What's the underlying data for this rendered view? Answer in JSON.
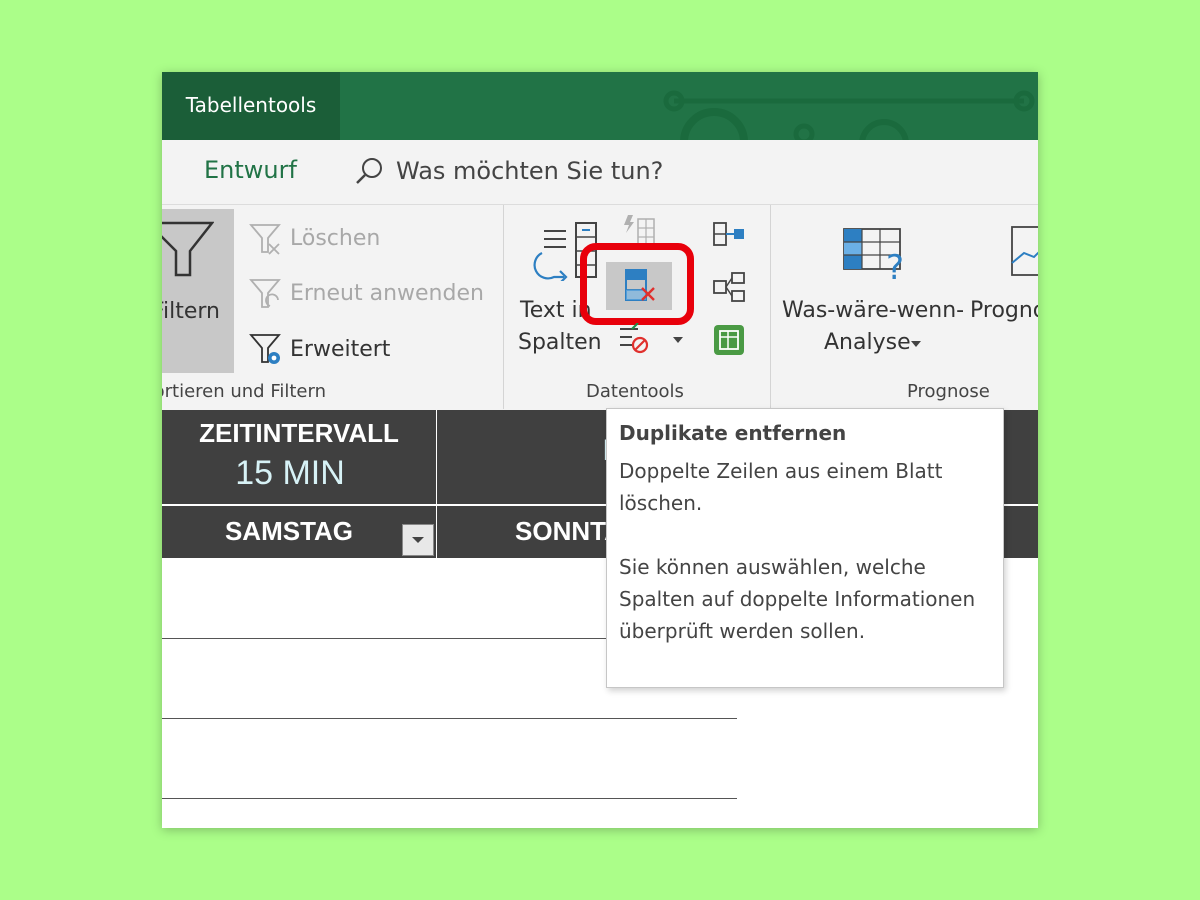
{
  "titlebar": {
    "context_tab": "Tabellentools"
  },
  "tabs": {
    "active": "Entwurf",
    "search_placeholder": "Was möchten Sie tun?"
  },
  "ribbon": {
    "sort_filter": {
      "filter_label": "Filtern",
      "clear_label": "Löschen",
      "reapply_label": "Erneut anwenden",
      "advanced_label": "Erweitert",
      "group_label": "Sortieren und Filtern"
    },
    "datatools": {
      "text_to_columns_line1": "Text in",
      "text_to_columns_line2": "Spalten",
      "group_label": "Datentools"
    },
    "forecast": {
      "whatif_line1": "Was-wäre-wenn-",
      "whatif_line2": "Analyse",
      "forecast_sheet": "Prognoseblatt",
      "group_label": "Prognose"
    }
  },
  "sheet": {
    "header": {
      "interval_title": "ZEITINTERVALL",
      "interval_value": "15 MIN",
      "second_col": "Kurs"
    },
    "days": [
      "SAMSTAG",
      "SONNTAG"
    ]
  },
  "tooltip": {
    "title": "Duplikate entfernen",
    "line1": "Doppelte Zeilen aus einem Blatt löschen.",
    "line2": "Sie können auswählen, welche Spalten auf doppelte Informationen überprüft werden sollen."
  },
  "colors": {
    "background": "#abfe89",
    "excel_green": "#217346",
    "context_tab": "#1b5e38",
    "highlight_ring": "#e8000b",
    "header_dark": "#404040"
  }
}
